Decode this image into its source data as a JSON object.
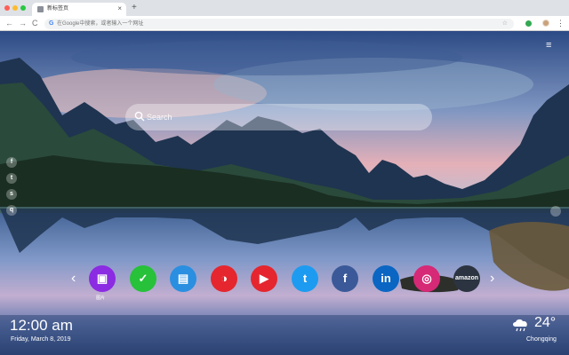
{
  "browser": {
    "tab_title": "新标签页",
    "tab_close": "×",
    "new_tab": "+",
    "omnibox_placeholder": "在Google中搜索，或者输入一个网址",
    "omnibox_logo": "G",
    "nav_back": "←",
    "nav_forward": "→",
    "nav_reload": "C",
    "star": "☆",
    "menu": "⋮"
  },
  "page": {
    "menu_icon": "≡",
    "search": {
      "placeholder": "Search"
    },
    "social": [
      {
        "name": "facebook-icon",
        "glyph": "f"
      },
      {
        "name": "twitter-icon",
        "glyph": "t"
      },
      {
        "name": "snapchat-icon",
        "glyph": "s"
      },
      {
        "name": "search-engine-icon",
        "glyph": "q"
      }
    ],
    "shortcuts": [
      {
        "name": "shortcut-gallery",
        "glyph": "▣",
        "color": "#8b2be2"
      },
      {
        "name": "shortcut-checklist",
        "glyph": "✓",
        "color": "#27c13a"
      },
      {
        "name": "shortcut-news",
        "glyph": "▤",
        "color": "#2a8fe0"
      },
      {
        "name": "shortcut-chrome-game",
        "glyph": "◑",
        "color": "#e5262e"
      },
      {
        "name": "shortcut-youtube",
        "glyph": "▶",
        "color": "#e5262e"
      },
      {
        "name": "shortcut-twitter",
        "glyph": "t",
        "color": "#1d9bf0"
      },
      {
        "name": "shortcut-facebook",
        "glyph": "f",
        "color": "#3b5998"
      },
      {
        "name": "shortcut-linkedin",
        "glyph": "in",
        "color": "#0a66c2"
      },
      {
        "name": "shortcut-instagram",
        "glyph": "◎",
        "color": "#d62976"
      },
      {
        "name": "shortcut-amazon",
        "glyph": "amazon",
        "color": "#2b3440"
      }
    ],
    "shortcut_label": "图片",
    "arrow_left": "‹",
    "arrow_right": "›",
    "clock": "12:00 am",
    "date": "Friday, March 8, 2019",
    "weather": {
      "temp": "24°",
      "city": "Chongqing",
      "icon": "cloud-rain-icon"
    }
  }
}
